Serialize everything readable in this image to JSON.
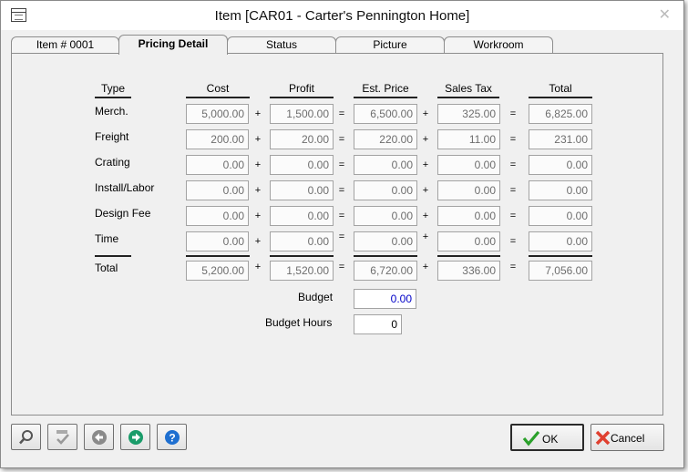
{
  "window": {
    "title": "Item [CAR01 - Carter's Pennington Home]"
  },
  "tabs": [
    {
      "label": "Item # 0001"
    },
    {
      "label": "Pricing Detail"
    },
    {
      "label": "Status"
    },
    {
      "label": "Picture"
    },
    {
      "label": "Workroom"
    }
  ],
  "headers": {
    "type": "Type",
    "cost": "Cost",
    "profit": "Profit",
    "est_price": "Est. Price",
    "sales_tax": "Sales Tax",
    "total": "Total"
  },
  "operators": {
    "plus": "+",
    "equals": "="
  },
  "rows": [
    {
      "label": "Merch.",
      "cost": "5,000.00",
      "profit": "1,500.00",
      "est_price": "6,500.00",
      "sales_tax": "325.00",
      "total": "6,825.00"
    },
    {
      "label": "Freight",
      "cost": "200.00",
      "profit": "20.00",
      "est_price": "220.00",
      "sales_tax": "11.00",
      "total": "231.00"
    },
    {
      "label": "Crating",
      "cost": "0.00",
      "profit": "0.00",
      "est_price": "0.00",
      "sales_tax": "0.00",
      "total": "0.00"
    },
    {
      "label": "Install/Labor",
      "cost": "0.00",
      "profit": "0.00",
      "est_price": "0.00",
      "sales_tax": "0.00",
      "total": "0.00"
    },
    {
      "label": "Design Fee",
      "cost": "0.00",
      "profit": "0.00",
      "est_price": "0.00",
      "sales_tax": "0.00",
      "total": "0.00"
    },
    {
      "label": "Time",
      "cost": "0.00",
      "profit": "0.00",
      "est_price": "0.00",
      "sales_tax": "0.00",
      "total": "0.00"
    }
  ],
  "totals": {
    "label": "Total",
    "cost": "5,200.00",
    "profit": "1,520.00",
    "est_price": "6,720.00",
    "sales_tax": "336.00",
    "total": "7,056.00"
  },
  "budget": {
    "label": "Budget",
    "value": "0.00"
  },
  "budget_hours": {
    "label": "Budget Hours",
    "value": "0"
  },
  "buttons": {
    "ok": "OK",
    "cancel": "Cancel"
  },
  "icons": {
    "find": "magnifier-icon",
    "spellcheck": "spellcheck-icon",
    "previous": "left-arrow-icon",
    "next": "right-arrow-icon",
    "help": "help-icon"
  },
  "colors": {
    "budget_value": "#0000c8",
    "next_button": "#1a9c6a",
    "help_button": "#1e6fd0",
    "ok_check": "#2aa02a",
    "cancel_x": "#e04030"
  }
}
